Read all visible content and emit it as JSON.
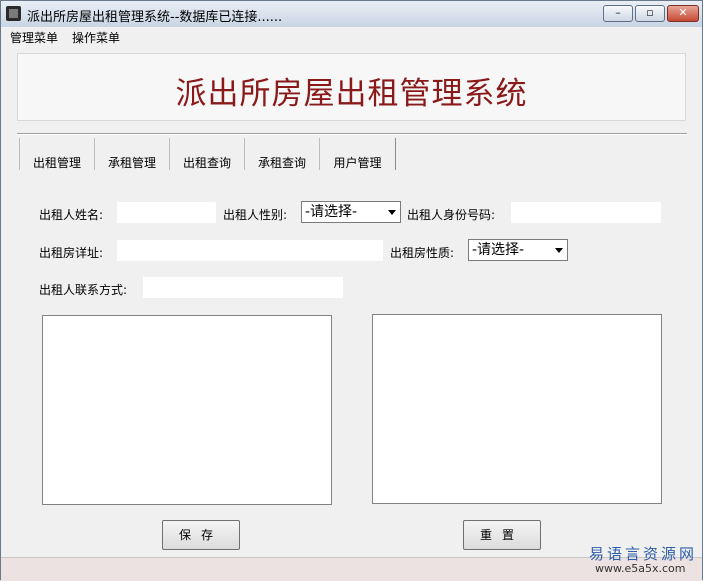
{
  "window": {
    "title": "派出所房屋出租管理系统--数据库已连接......",
    "controls": {
      "minimize": "–",
      "maximize": "▫",
      "close": "✕"
    }
  },
  "menu": [
    {
      "label": "管理菜单"
    },
    {
      "label": "操作菜单"
    }
  ],
  "banner": {
    "title": "派出所房屋出租管理系统"
  },
  "tabs": [
    {
      "label": "出租管理"
    },
    {
      "label": "承租管理"
    },
    {
      "label": "出租查询"
    },
    {
      "label": "承租查询"
    },
    {
      "label": "用户管理"
    }
  ],
  "form": {
    "landlord_name_label": "出租人姓名:",
    "landlord_name_value": "",
    "landlord_gender_label": "出租人性别:",
    "landlord_gender_selected": "-请选择-",
    "landlord_id_label": "出租人身份号码:",
    "landlord_id_value": "",
    "house_address_label": "出租房详址:",
    "house_address_value": "",
    "house_nature_label": "出租房性质:",
    "house_nature_selected": "-请选择-",
    "landlord_contact_label": "出租人联系方式:",
    "landlord_contact_value": ""
  },
  "buttons": {
    "save": "保存",
    "reset": "重置"
  },
  "watermark": {
    "line1": "易语言资源网",
    "line2": "www.e5a5x.com"
  },
  "colors": {
    "banner_title": "#8a1a1a",
    "watermark": "#2e5da8"
  }
}
